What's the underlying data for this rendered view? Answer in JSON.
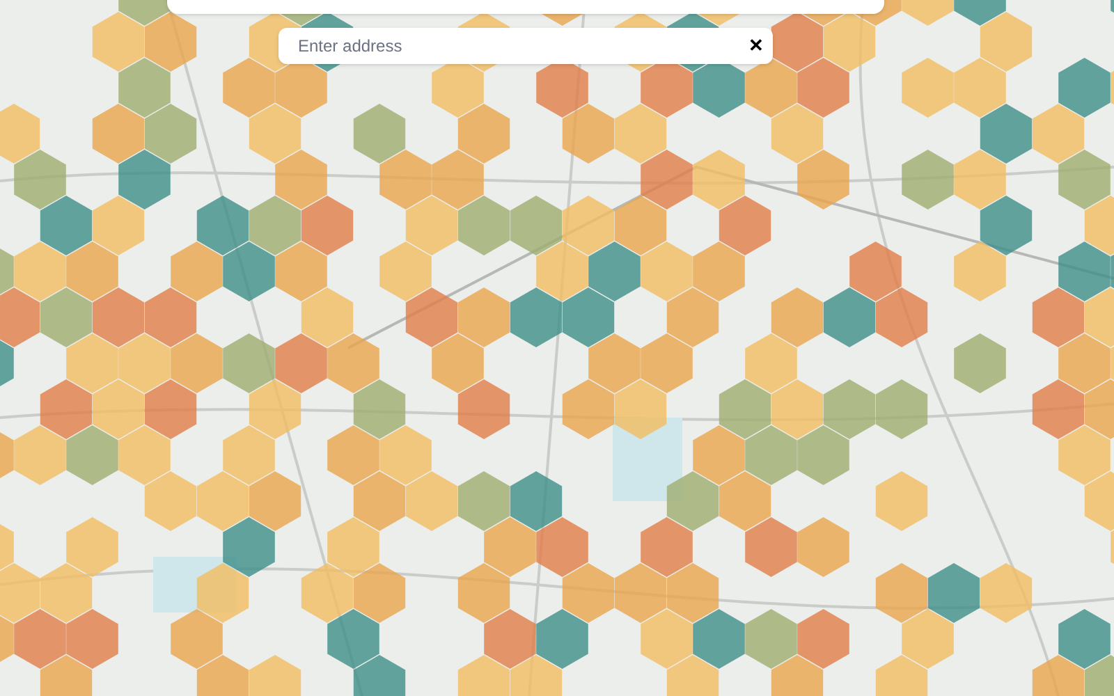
{
  "address_search": {
    "placeholder": "Enter address",
    "clear_button": "✕"
  }
}
